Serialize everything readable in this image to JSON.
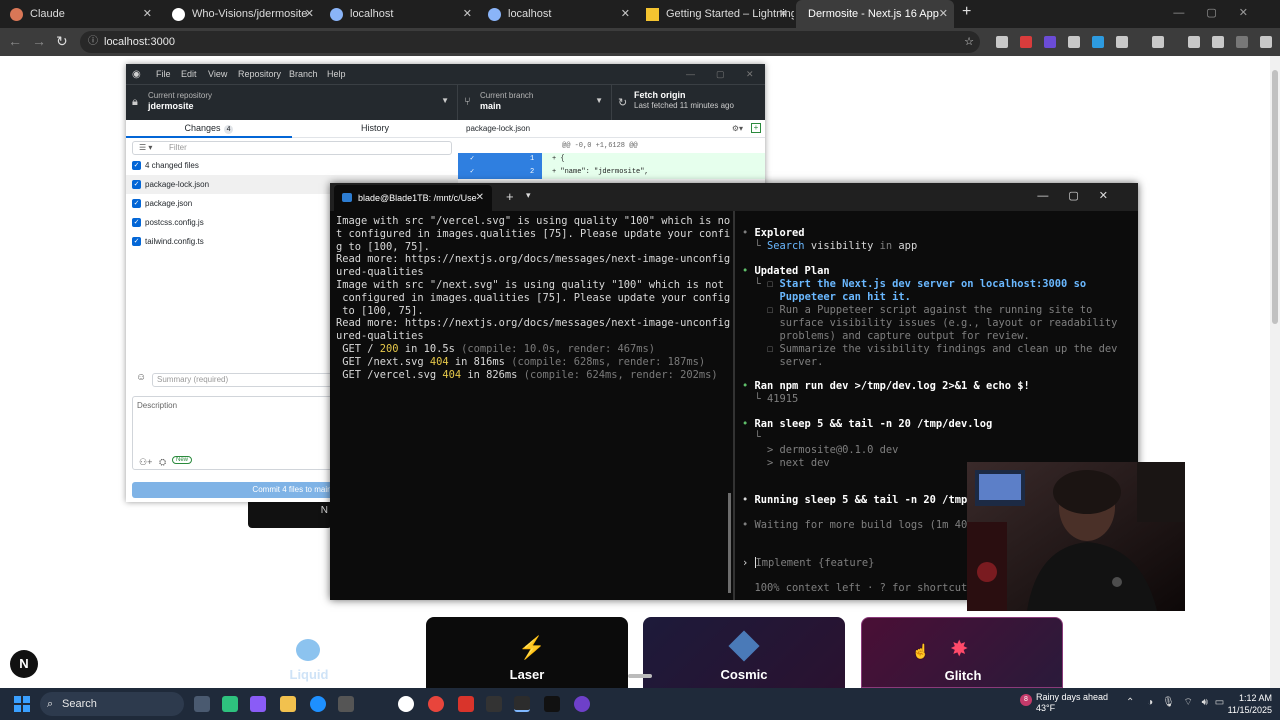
{
  "browser": {
    "tabs": [
      {
        "label": "Claude",
        "color": "#d97757"
      },
      {
        "label": "Who-Visions/jdermosite",
        "color": "#ffffff"
      },
      {
        "label": "localhost",
        "color": "#8ab4f8"
      },
      {
        "label": "localhost",
        "color": "#8ab4f8"
      },
      {
        "label": "Getting Started – Lightning CSS",
        "color": "#f4c430"
      },
      {
        "label": "Dermosite - Next.js 16 App",
        "color": "#8ab4f8"
      }
    ],
    "url": "localhost:3000"
  },
  "github_desktop": {
    "menu": [
      "File",
      "Edit",
      "View",
      "Repository",
      "Branch",
      "Help"
    ],
    "repo_label": "Current repository",
    "repo_value": "jdermosite",
    "branch_label": "Current branch",
    "branch_value": "main",
    "fetch_label": "Fetch origin",
    "fetch_sub": "Last fetched 11 minutes ago",
    "tab_changes": "Changes",
    "tab_changes_count": "4",
    "tab_history": "History",
    "filter_placeholder": "Filter",
    "changed_files_label": "4 changed files",
    "files": [
      "package-lock.json",
      "package.json",
      "postcss.config.js",
      "tailwind.config.ts"
    ],
    "summary_placeholder": "Summary (required)",
    "description_placeholder": "Description",
    "new_badge": "New",
    "commit_button": "Commit 4 files to main",
    "diff_file": "package-lock.json",
    "diff_hunk": "@@ -0,0 +1,6128 @@",
    "diff_lines": [
      {
        "num": "1",
        "text": "+  {"
      },
      {
        "num": "2",
        "text": "+    \"name\": \"jdermosite\","
      }
    ]
  },
  "terminal": {
    "tab_title": "blade@Blade1TB: /mnt/c/Use",
    "left_lines": [
      "Image with src \"/vercel.svg\" is using quality \"100\" which is no",
      "t configured in images.qualities [75]. Please update your confi",
      "g to [100, 75].",
      "Read more: https://nextjs.org/docs/messages/next-image-unconfig",
      "ured-qualities",
      "Image with src \"/next.svg\" is using quality \"100\" which is not",
      " configured in images.qualities [75]. Please update your config",
      " to [100, 75].",
      "Read more: https://nextjs.org/docs/messages/next-image-unconfig",
      "ured-qualities"
    ],
    "requests": [
      {
        "prefix": " GET / ",
        "code": "200",
        "mid": " in 10.5s ",
        "detail": "(compile: 10.0s, render: 467ms)"
      },
      {
        "prefix": " GET /next.svg ",
        "code": "404",
        "mid": " in 816ms ",
        "detail": "(compile: 628ms, render: 187ms)"
      },
      {
        "prefix": " GET /vercel.svg ",
        "code": "404",
        "mid": " in 826ms ",
        "detail": "(compile: 624ms, render: 202ms)"
      }
    ],
    "right": {
      "explored_title": "Explored",
      "explored_verb": "Search",
      "explored_rest": " visibility ",
      "explored_in": "in",
      "explored_target": " app",
      "plan_title": "Updated Plan",
      "plan_items": [
        [
          "Start the Next.js dev server on localhost:3000 so",
          "Puppeteer can hit it."
        ],
        [
          "Run a Puppeteer script against the running site to",
          "surface visibility issues (e.g., layout or readability",
          "problems) and capture output for review."
        ],
        [
          "Summarize the visibility findings and clean up the dev",
          "server."
        ]
      ],
      "ran1_cmd": "Ran npm run dev >/tmp/dev.log 2>&1 & echo $!",
      "ran1_out": "41915",
      "ran2_cmd": "Ran sleep 5 && tail -n 20 /tmp/dev.log",
      "ran2_out1": "> dermosite@0.1.0 dev",
      "ran2_out2": "> next dev",
      "running_cmd": "Running sleep 5 && tail -n 20 /tmp/d",
      "waiting": "Waiting for more build logs (1m 40s",
      "input_placeholder": "Implement {feature}",
      "status": "100% context left · ? for shortcuts"
    }
  },
  "page": {
    "partial_button": "N",
    "cards": [
      {
        "label": "Liquid",
        "bg": "#ffffff",
        "fg": "#cfe3f7"
      },
      {
        "label": "Laser",
        "bg": "#0b0b0b",
        "fg": "#ffffff"
      },
      {
        "label": "Cosmic",
        "bg": "#1c1630",
        "fg": "#ffffff"
      },
      {
        "label": "Glitch",
        "bg": "#3a0f2e",
        "fg": "#ffffff"
      }
    ],
    "n_badge": "N"
  },
  "taskbar": {
    "search": "Search",
    "weather_title": "Rainy days ahead",
    "weather_temp": "43°F",
    "weather_badge": "8",
    "time": "1:12 AM",
    "date": "11/15/2025"
  }
}
